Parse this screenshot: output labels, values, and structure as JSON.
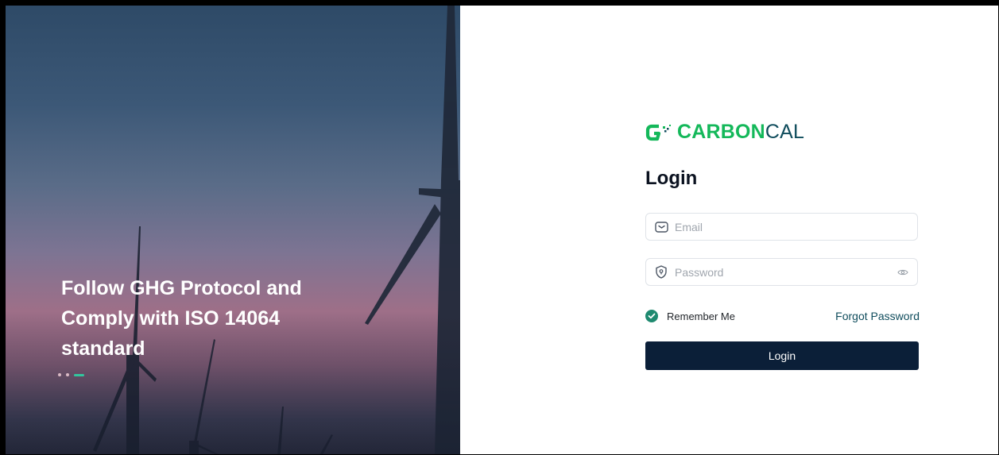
{
  "hero": {
    "tagline": "Follow GHG Protocol and Comply with ISO 14064 standard",
    "slides": 3,
    "active_slide": 3
  },
  "brand": {
    "name_bold": "CARBON",
    "name_light": "CAL",
    "colors": {
      "green": "#14b85a",
      "teal": "#0f4c5c"
    }
  },
  "form": {
    "title": "Login",
    "email_placeholder": "Email",
    "password_placeholder": "Password",
    "remember_label": "Remember Me",
    "remember_checked": true,
    "forgot_label": "Forgot Password",
    "submit_label": "Login"
  },
  "icons": {
    "email": "mail-icon",
    "password": "shield-icon",
    "toggle": "eye-icon",
    "check": "check-icon"
  },
  "colors": {
    "button": "#0b1f38",
    "checkbox": "#1f8a70"
  }
}
